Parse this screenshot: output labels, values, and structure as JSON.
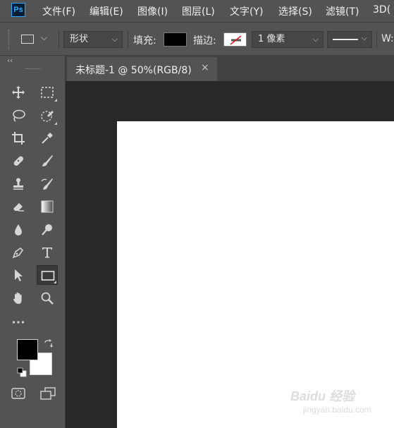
{
  "app": {
    "logo_text": "Ps"
  },
  "menu": [
    {
      "label": "文件(F)"
    },
    {
      "label": "编辑(E)"
    },
    {
      "label": "图像(I)"
    },
    {
      "label": "图层(L)"
    },
    {
      "label": "文字(Y)"
    },
    {
      "label": "选择(S)"
    },
    {
      "label": "滤镜(T)"
    },
    {
      "label": "3D("
    }
  ],
  "options": {
    "mode_value": "形状",
    "fill_label": "填充:",
    "fill_color": "#000000",
    "stroke_label": "描边:",
    "stroke_color": "none",
    "stroke_width_value": "1 像素",
    "width_label": "W:"
  },
  "document": {
    "tab_title": "未标题-1 @ 50%(RGB/8)",
    "close_glyph": "×",
    "canvas_color": "#ffffff"
  },
  "toolbar": {
    "collapse_glyph": "‹‹",
    "active_tool": "rectangle-tool",
    "foreground_color": "#000000",
    "background_color": "#ffffff",
    "tools": [
      "move-tool",
      "marquee-tool",
      "lasso-tool",
      "quick-selection-tool",
      "crop-tool",
      "eyedropper-tool",
      "healing-brush-tool",
      "brush-tool",
      "clone-stamp-tool",
      "history-brush-tool",
      "eraser-tool",
      "gradient-tool",
      "blur-tool",
      "dodge-tool",
      "pen-tool",
      "type-tool",
      "path-selection-tool",
      "rectangle-tool",
      "hand-tool",
      "zoom-tool",
      "more-tools"
    ]
  },
  "watermark": {
    "text": "Baidu 经验",
    "sub": "jingyan.baidu.com"
  }
}
